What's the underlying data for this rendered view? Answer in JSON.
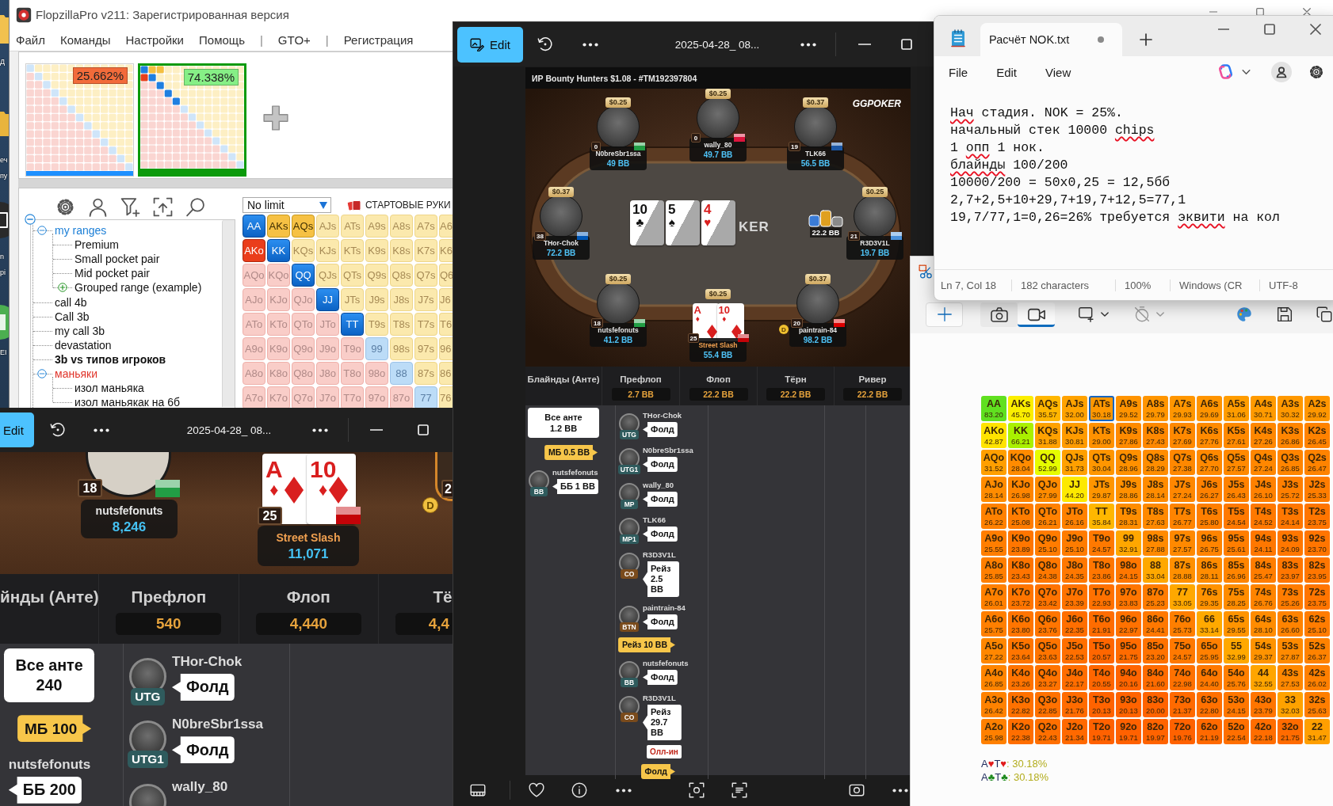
{
  "desktop": {
    "icon_labels": [
      "Д",
      "еч",
      "пу",
      "n",
      "pi",
      "EI"
    ]
  },
  "flopzilla": {
    "title": "FlopzillaPro v211: Зарегистрированная версия",
    "menu": [
      {
        "label": "Файл",
        "kind": "item"
      },
      {
        "label": "Команды",
        "kind": "item"
      },
      {
        "label": "Настройки",
        "kind": "item"
      },
      {
        "label": "Помощь",
        "kind": "item"
      },
      {
        "label": "|",
        "kind": "separator"
      },
      {
        "label": "GTO+",
        "kind": "item"
      },
      {
        "label": "|",
        "kind": "separator"
      },
      {
        "label": "Регистрация",
        "kind": "item"
      }
    ],
    "ranges": [
      {
        "percent": "25.662%",
        "color": "#f26b3a",
        "selected": false
      },
      {
        "percent": "74.338%",
        "color": "#86ef86",
        "selected": true
      }
    ],
    "game_select": {
      "value": "No limit"
    },
    "hands_title": "СТАРТОВЫЕ РУКИ",
    "tree": {
      "expanded": true,
      "children": [
        {
          "label": "my ranges",
          "color": "#1a7ed6",
          "bold": false,
          "expanded": true,
          "children": [
            {
              "label": "Premium",
              "color": "#111111",
              "bold": false
            },
            {
              "label": "Small pocket pair",
              "color": "#111111",
              "bold": false
            },
            {
              "label": "Mid pocket pair",
              "color": "#111111",
              "bold": false
            },
            {
              "label": "Grouped range (example)",
              "color": "#111111",
              "bold": false,
              "expanded": false
            }
          ]
        },
        {
          "label": "call 4b",
          "color": "#111111",
          "bold": false
        },
        {
          "label": "Call 3b",
          "color": "#111111",
          "bold": false
        },
        {
          "label": "my call 3b",
          "color": "#111111",
          "bold": false
        },
        {
          "label": "devastation",
          "color": "#111111",
          "bold": false
        },
        {
          "label": "3b vs типов игроков",
          "color": "#111111",
          "bold": true
        },
        {
          "label": "маньяки",
          "color": "#e0342a",
          "bold": false,
          "expanded": true,
          "children": [
            {
              "label": "изол маньяка",
              "color": "#111111",
              "bold": false
            },
            {
              "label": "изол маньякак на 6б",
              "color": "#111111",
              "bold": false
            }
          ]
        }
      ]
    },
    "matrix": [
      [
        {
          "label": "AA",
          "kind": "pair",
          "selected": true
        },
        {
          "label": "AKs",
          "kind": "suited",
          "selected": true
        },
        {
          "label": "AQs",
          "kind": "suited",
          "selected": true
        },
        {
          "label": "AJs",
          "kind": "suited",
          "selected": false
        },
        {
          "label": "ATs",
          "kind": "suited",
          "selected": false
        },
        {
          "label": "A9s",
          "kind": "suited",
          "selected": false
        },
        {
          "label": "A8s",
          "kind": "suited",
          "selected": false
        },
        {
          "label": "A7s",
          "kind": "suited",
          "selected": false
        },
        {
          "label": "A6",
          "kind": "suited",
          "selected": false
        }
      ],
      [
        {
          "label": "AKo",
          "kind": "offsuit",
          "selected": true
        },
        {
          "label": "KK",
          "kind": "pair",
          "selected": true
        },
        {
          "label": "KQs",
          "kind": "suited",
          "selected": false
        },
        {
          "label": "KJs",
          "kind": "suited",
          "selected": false
        },
        {
          "label": "KTs",
          "kind": "suited",
          "selected": false
        },
        {
          "label": "K9s",
          "kind": "suited",
          "selected": false
        },
        {
          "label": "K8s",
          "kind": "suited",
          "selected": false
        },
        {
          "label": "K7s",
          "kind": "suited",
          "selected": false
        },
        {
          "label": "K6",
          "kind": "suited",
          "selected": false
        }
      ],
      [
        {
          "label": "AQo",
          "kind": "offsuit",
          "selected": false
        },
        {
          "label": "KQo",
          "kind": "offsuit",
          "selected": false
        },
        {
          "label": "QQ",
          "kind": "pair",
          "selected": true
        },
        {
          "label": "QJs",
          "kind": "suited",
          "selected": false
        },
        {
          "label": "QTs",
          "kind": "suited",
          "selected": false
        },
        {
          "label": "Q9s",
          "kind": "suited",
          "selected": false
        },
        {
          "label": "Q8s",
          "kind": "suited",
          "selected": false
        },
        {
          "label": "Q7s",
          "kind": "suited",
          "selected": false
        },
        {
          "label": "Q6",
          "kind": "suited",
          "selected": false
        }
      ],
      [
        {
          "label": "AJo",
          "kind": "offsuit",
          "selected": false
        },
        {
          "label": "KJo",
          "kind": "offsuit",
          "selected": false
        },
        {
          "label": "QJo",
          "kind": "offsuit",
          "selected": false
        },
        {
          "label": "JJ",
          "kind": "pair",
          "selected": true
        },
        {
          "label": "JTs",
          "kind": "suited",
          "selected": false
        },
        {
          "label": "J9s",
          "kind": "suited",
          "selected": false
        },
        {
          "label": "J8s",
          "kind": "suited",
          "selected": false
        },
        {
          "label": "J7s",
          "kind": "suited",
          "selected": false
        },
        {
          "label": "J6",
          "kind": "suited",
          "selected": false
        }
      ],
      [
        {
          "label": "ATo",
          "kind": "offsuit",
          "selected": false
        },
        {
          "label": "KTo",
          "kind": "offsuit",
          "selected": false
        },
        {
          "label": "QTo",
          "kind": "offsuit",
          "selected": false
        },
        {
          "label": "JTo",
          "kind": "offsuit",
          "selected": false
        },
        {
          "label": "TT",
          "kind": "pair",
          "selected": true
        },
        {
          "label": "T9s",
          "kind": "suited",
          "selected": false
        },
        {
          "label": "T8s",
          "kind": "suited",
          "selected": false
        },
        {
          "label": "T7s",
          "kind": "suited",
          "selected": false
        },
        {
          "label": "T6",
          "kind": "suited",
          "selected": false
        }
      ],
      [
        {
          "label": "A9o",
          "kind": "offsuit",
          "selected": false
        },
        {
          "label": "K9o",
          "kind": "offsuit",
          "selected": false
        },
        {
          "label": "Q9o",
          "kind": "offsuit",
          "selected": false
        },
        {
          "label": "J9o",
          "kind": "offsuit",
          "selected": false
        },
        {
          "label": "T9o",
          "kind": "offsuit",
          "selected": false
        },
        {
          "label": "99",
          "kind": "pair",
          "selected": false
        },
        {
          "label": "98s",
          "kind": "suited",
          "selected": false
        },
        {
          "label": "97s",
          "kind": "suited",
          "selected": false
        },
        {
          "label": "96",
          "kind": "suited",
          "selected": false
        }
      ],
      [
        {
          "label": "A8o",
          "kind": "offsuit",
          "selected": false
        },
        {
          "label": "K8o",
          "kind": "offsuit",
          "selected": false
        },
        {
          "label": "Q8o",
          "kind": "offsuit",
          "selected": false
        },
        {
          "label": "J8o",
          "kind": "offsuit",
          "selected": false
        },
        {
          "label": "T8o",
          "kind": "offsuit",
          "selected": false
        },
        {
          "label": "98o",
          "kind": "offsuit",
          "selected": false
        },
        {
          "label": "88",
          "kind": "pair",
          "selected": false
        },
        {
          "label": "87s",
          "kind": "suited",
          "selected": false
        },
        {
          "label": "86",
          "kind": "suited",
          "selected": false
        }
      ],
      [
        {
          "label": "A7o",
          "kind": "offsuit",
          "selected": false
        },
        {
          "label": "K7o",
          "kind": "offsuit",
          "selected": false
        },
        {
          "label": "Q7o",
          "kind": "offsuit",
          "selected": false
        },
        {
          "label": "J7o",
          "kind": "offsuit",
          "selected": false
        },
        {
          "label": "T7o",
          "kind": "offsuit",
          "selected": false
        },
        {
          "label": "97o",
          "kind": "offsuit",
          "selected": false
        },
        {
          "label": "87o",
          "kind": "offsuit",
          "selected": false
        },
        {
          "label": "77",
          "kind": "pair",
          "selected": false
        },
        {
          "label": "76",
          "kind": "suited",
          "selected": false
        }
      ]
    ]
  },
  "viewer_left": {
    "edit_button": "Edit",
    "title": "2025-04-28_ 08...",
    "seats": [
      {
        "name": "nutsfefonuts",
        "stack": "8,246",
        "badge": "18",
        "flag": {
          "color": "#229e45"
        },
        "hero": false
      },
      {
        "name": "Street Slash",
        "stack": "11,071",
        "badge": "25",
        "flag": {
          "color": "#c40308"
        },
        "hero": true,
        "cards": [
          {
            "rank": "A",
            "suit": "♦",
            "color": "#d91f1f",
            "kind": "diamond"
          },
          {
            "rank": "10",
            "suit": "♦",
            "color": "#d91f1f",
            "kind": "diamond"
          }
        ]
      }
    ],
    "edge_seat": {
      "badge": "2",
      "dealer": "D"
    },
    "hand_history": {
      "streets": [
        {
          "label": "йнды (Анте)"
        },
        {
          "label": "Префлоп",
          "pot": "540"
        },
        {
          "label": "Флоп",
          "pot": "4,440"
        },
        {
          "label": "Тё",
          "pot": "4,4"
        }
      ],
      "columns": [
        [
          {
            "kind": "ante",
            "label": "Все анте",
            "amount": "240"
          },
          {
            "kind": "own",
            "action": "МБ 100"
          },
          {
            "kind": "player",
            "name": "nutsfefonuts",
            "avatar": false,
            "action": "ББ 200"
          }
        ],
        [
          {
            "kind": "player",
            "name": "THor-Chok",
            "avatar": true,
            "position": "UTG",
            "color": "#2f5b5d",
            "action": "Фолд"
          },
          {
            "kind": "player",
            "name": "N0breSbr1ssa",
            "avatar": true,
            "position": "UTG1",
            "color": "#2f5b5d",
            "action": "Фолд"
          },
          {
            "kind": "player",
            "name": "wally_80",
            "avatar": true
          }
        ]
      ]
    }
  },
  "viewer_center": {
    "edit_button": "Edit",
    "title": "2025-04-28_ 08...",
    "table_header": "ИР Bounty Hunters $1.08 - #TM192397804",
    "logo": "GGPOKER",
    "felt_text": "KER",
    "board": [
      {
        "rank": "10",
        "suit": "♣",
        "color": "#111111"
      },
      {
        "rank": "5",
        "suit": "♠",
        "color": "#111111"
      },
      {
        "rank": "4",
        "suit": "♥",
        "color": "#d91f1f"
      }
    ],
    "bet": "22.2 BB",
    "seats": [
      {
        "name": "N0breSbr1ssa",
        "stack": "49 BB",
        "bounty": "$0.25",
        "badge": "0",
        "flag": {
          "color": "#229e45"
        },
        "hero": false
      },
      {
        "name": "wally_80",
        "stack": "49.7 BB",
        "bounty": "$0.25",
        "badge": "0",
        "flag": {
          "color": "#dc143c"
        },
        "hero": false
      },
      {
        "name": "TLK66",
        "stack": "56.5 BB",
        "bounty": "$0.37",
        "badge": "19",
        "flag": {
          "color": "#1c57a5"
        },
        "hero": false
      },
      {
        "name": "THor-Chok",
        "stack": "72.2 BB",
        "bounty": "$0.37",
        "badge": "38",
        "flag": {
          "color": "#0057b7"
        },
        "hero": false
      },
      {
        "name": "R3D3V1L",
        "stack": "19.7 BB",
        "bounty": "$0.25",
        "badge": "21",
        "flag": {
          "color": "#4a90d9"
        },
        "hero": false
      },
      {
        "name": "nutsfefonuts",
        "stack": "41.2 BB",
        "bounty": "$0.25",
        "badge": "18",
        "flag": {
          "color": "#229e45"
        },
        "hero": false
      },
      {
        "name": "Street Slash",
        "stack": "55.4 BB",
        "bounty": "$0.25",
        "badge": "25",
        "flag": {
          "color": "#c40308"
        },
        "hero": true,
        "cards": [
          {
            "rank": "A",
            "suit": "♦",
            "color": "#d91f1f",
            "kind": "diamond"
          },
          {
            "rank": "10",
            "suit": "♦",
            "color": "#d91f1f",
            "kind": "diamond"
          }
        ]
      },
      {
        "name": "paintrain-84",
        "stack": "98.2 BB",
        "bounty": "$0.37",
        "badge": "20",
        "flag": {
          "color": "#dd0000"
        },
        "hero": false,
        "dealer": "D"
      }
    ],
    "hand_history": {
      "streets": [
        {
          "label": "Блайнды (Анте)"
        },
        {
          "label": "Префлоп",
          "pot": "2.7 BB"
        },
        {
          "label": "Флоп",
          "pot": "22.2 BB"
        },
        {
          "label": "Тёрн",
          "pot": "22.2 BB"
        },
        {
          "label": "Ривер",
          "pot": "22.2 BB"
        }
      ],
      "columns": [
        [
          {
            "kind": "ante",
            "label": "Все анте",
            "amount": "1.2 BB"
          },
          {
            "kind": "own",
            "action": "МБ 0.5 BB"
          },
          {
            "kind": "player",
            "name": "nutsfefonuts",
            "avatar": true,
            "position": "BB",
            "color": "#2f5b5d",
            "action": "ББ 1 BB"
          }
        ],
        [
          {
            "kind": "player",
            "name": "THor-Chok",
            "avatar": true,
            "position": "UTG",
            "color": "#2f5b5d",
            "action": "Фолд"
          },
          {
            "kind": "player",
            "name": "N0breSbr1ssa",
            "avatar": true,
            "position": "UTG1",
            "color": "#2f5b5d",
            "action": "Фолд"
          },
          {
            "kind": "player",
            "name": "wally_80",
            "avatar": true,
            "position": "MP",
            "color": "#2f5b5d",
            "action": "Фолд"
          },
          {
            "kind": "player",
            "name": "TLK66",
            "avatar": true,
            "position": "MP1",
            "color": "#2f5b5d",
            "action": "Фолд"
          },
          {
            "kind": "player",
            "name": "R3D3V1L",
            "avatar": true,
            "position": "CO",
            "color": "#7a4b1c",
            "action": "Рейз 2.5 BB"
          },
          {
            "kind": "player",
            "name": "paintrain-84",
            "avatar": true,
            "position": "BTN",
            "color": "#7a4b1c",
            "action": "Фолд"
          },
          {
            "kind": "own",
            "action": "Рейз 10 BB"
          },
          {
            "kind": "player",
            "name": "nutsfefonuts",
            "avatar": true,
            "position": "BB",
            "color": "#2f5b5d",
            "action": "Фолд"
          },
          {
            "kind": "player",
            "name": "R3D3V1L",
            "avatar": true,
            "position": "CO",
            "color": "#7a4b1c",
            "action": "Рейз 29.7 BB",
            "tag": "Олл-ин"
          },
          {
            "kind": "own",
            "action": "Фолд"
          }
        ]
      ]
    }
  },
  "notepad": {
    "tab_title": "Расчёт NOK.txt",
    "unsaved": true,
    "menu": [
      "File",
      "Edit",
      "View"
    ],
    "lines": [
      [
        {
          "text": "Нач",
          "misspelled": true
        },
        {
          "text": " стадия. NOK = 25%.",
          "misspelled": false
        }
      ],
      [
        {
          "text": "начальный стек 10000 ",
          "misspelled": false
        },
        {
          "text": "chips",
          "misspelled": true
        }
      ],
      [
        {
          "text": "1 ",
          "misspelled": false
        },
        {
          "text": "опп",
          "misspelled": true
        },
        {
          "text": " 1 нок.",
          "misspelled": false
        }
      ],
      [
        {
          "text": "блайнды",
          "misspelled": true
        },
        {
          "text": " 100/200",
          "misspelled": false
        }
      ],
      [
        {
          "text": "10000/200 = 50x0,25 = 12,5бб",
          "misspelled": false
        }
      ],
      [
        {
          "text": "2,7+2,5+10+29,7+19,7+12,5=77,1",
          "misspelled": false
        }
      ],
      [
        {
          "text": "19,7/77,1=0,26=26% требуется ",
          "misspelled": false
        },
        {
          "text": "эквити",
          "misspelled": true
        },
        {
          "text": " на кол",
          "misspelled": false
        }
      ]
    ],
    "status": [
      "Ln 7, Col 18",
      "182 characters",
      "100%",
      "Windows (CR",
      "UTF-8"
    ]
  },
  "snipping": {
    "capture_modes": [
      {
        "kind": "photo",
        "selected": false
      },
      {
        "kind": "video",
        "selected": true
      }
    ]
  },
  "equity_grid": {
    "rows": [
      [
        {
          "hand": "AA",
          "equity": "83.20",
          "selected": false
        },
        {
          "hand": "AKs",
          "equity": "45.70",
          "selected": false
        },
        {
          "hand": "AQs",
          "equity": "35.57",
          "selected": false
        },
        {
          "hand": "AJs",
          "equity": "32.00",
          "selected": false
        },
        {
          "hand": "ATs",
          "equity": "30.18",
          "selected": true
        },
        {
          "hand": "A9s",
          "equity": "29.52",
          "selected": false
        },
        {
          "hand": "A8s",
          "equity": "29.79",
          "selected": false
        },
        {
          "hand": "A7s",
          "equity": "29.93",
          "selected": false
        },
        {
          "hand": "A6s",
          "equity": "29.69",
          "selected": false
        },
        {
          "hand": "A5s",
          "equity": "31.06",
          "selected": false
        },
        {
          "hand": "A4s",
          "equity": "30.71",
          "selected": false
        },
        {
          "hand": "A3s",
          "equity": "30.32",
          "selected": false
        },
        {
          "hand": "A2s",
          "equity": "29.92",
          "selected": false
        }
      ],
      [
        {
          "hand": "AKo",
          "equity": "42.87",
          "selected": false
        },
        {
          "hand": "KK",
          "equity": "66.21",
          "selected": false
        },
        {
          "hand": "KQs",
          "equity": "31.88",
          "selected": false
        },
        {
          "hand": "KJs",
          "equity": "30.81",
          "selected": false
        },
        {
          "hand": "KTs",
          "equity": "29.00",
          "selected": false
        },
        {
          "hand": "K9s",
          "equity": "27.86",
          "selected": false
        },
        {
          "hand": "K8s",
          "equity": "27.43",
          "selected": false
        },
        {
          "hand": "K7s",
          "equity": "27.69",
          "selected": false
        },
        {
          "hand": "K6s",
          "equity": "27.76",
          "selected": false
        },
        {
          "hand": "K5s",
          "equity": "27.61",
          "selected": false
        },
        {
          "hand": "K4s",
          "equity": "27.26",
          "selected": false
        },
        {
          "hand": "K3s",
          "equity": "26.86",
          "selected": false
        },
        {
          "hand": "K2s",
          "equity": "26.45",
          "selected": false
        }
      ],
      [
        {
          "hand": "AQo",
          "equity": "31.52",
          "selected": false
        },
        {
          "hand": "KQo",
          "equity": "28.04",
          "selected": false
        },
        {
          "hand": "QQ",
          "equity": "52.99",
          "selected": false
        },
        {
          "hand": "QJs",
          "equity": "31.73",
          "selected": false
        },
        {
          "hand": "QTs",
          "equity": "30.04",
          "selected": false
        },
        {
          "hand": "Q9s",
          "equity": "28.96",
          "selected": false
        },
        {
          "hand": "Q8s",
          "equity": "28.29",
          "selected": false
        },
        {
          "hand": "Q7s",
          "equity": "27.38",
          "selected": false
        },
        {
          "hand": "Q6s",
          "equity": "27.70",
          "selected": false
        },
        {
          "hand": "Q5s",
          "equity": "27.57",
          "selected": false
        },
        {
          "hand": "Q4s",
          "equity": "27.24",
          "selected": false
        },
        {
          "hand": "Q3s",
          "equity": "26.85",
          "selected": false
        },
        {
          "hand": "Q2s",
          "equity": "26.47",
          "selected": false
        }
      ],
      [
        {
          "hand": "AJo",
          "equity": "28.14",
          "selected": false
        },
        {
          "hand": "KJo",
          "equity": "26.98",
          "selected": false
        },
        {
          "hand": "QJo",
          "equity": "27.99",
          "selected": false
        },
        {
          "hand": "JJ",
          "equity": "44.20",
          "selected": false
        },
        {
          "hand": "JTs",
          "equity": "29.87",
          "selected": false
        },
        {
          "hand": "J9s",
          "equity": "28.86",
          "selected": false
        },
        {
          "hand": "J8s",
          "equity": "28.14",
          "selected": false
        },
        {
          "hand": "J7s",
          "equity": "27.24",
          "selected": false
        },
        {
          "hand": "J6s",
          "equity": "26.27",
          "selected": false
        },
        {
          "hand": "J5s",
          "equity": "26.43",
          "selected": false
        },
        {
          "hand": "J4s",
          "equity": "26.10",
          "selected": false
        },
        {
          "hand": "J3s",
          "equity": "25.72",
          "selected": false
        },
        {
          "hand": "J2s",
          "equity": "25.33",
          "selected": false
        }
      ],
      [
        {
          "hand": "ATo",
          "equity": "26.22",
          "selected": false
        },
        {
          "hand": "KTo",
          "equity": "25.08",
          "selected": false
        },
        {
          "hand": "QTo",
          "equity": "26.21",
          "selected": false
        },
        {
          "hand": "JTo",
          "equity": "26.16",
          "selected": false
        },
        {
          "hand": "TT",
          "equity": "35.84",
          "selected": false
        },
        {
          "hand": "T9s",
          "equity": "28.31",
          "selected": false
        },
        {
          "hand": "T8s",
          "equity": "27.63",
          "selected": false
        },
        {
          "hand": "T7s",
          "equity": "26.77",
          "selected": false
        },
        {
          "hand": "T6s",
          "equity": "25.80",
          "selected": false
        },
        {
          "hand": "T5s",
          "equity": "24.54",
          "selected": false
        },
        {
          "hand": "T4s",
          "equity": "24.52",
          "selected": false
        },
        {
          "hand": "T3s",
          "equity": "24.14",
          "selected": false
        },
        {
          "hand": "T2s",
          "equity": "23.75",
          "selected": false
        }
      ],
      [
        {
          "hand": "A9o",
          "equity": "25.55",
          "selected": false
        },
        {
          "hand": "K9o",
          "equity": "23.89",
          "selected": false
        },
        {
          "hand": "Q9o",
          "equity": "25.10",
          "selected": false
        },
        {
          "hand": "J9o",
          "equity": "25.10",
          "selected": false
        },
        {
          "hand": "T9o",
          "equity": "24.57",
          "selected": false
        },
        {
          "hand": "99",
          "equity": "32.91",
          "selected": false
        },
        {
          "hand": "98s",
          "equity": "27.88",
          "selected": false
        },
        {
          "hand": "97s",
          "equity": "27.57",
          "selected": false
        },
        {
          "hand": "96s",
          "equity": "26.75",
          "selected": false
        },
        {
          "hand": "95s",
          "equity": "25.61",
          "selected": false
        },
        {
          "hand": "94s",
          "equity": "24.11",
          "selected": false
        },
        {
          "hand": "93s",
          "equity": "24.09",
          "selected": false
        },
        {
          "hand": "92s",
          "equity": "23.70",
          "selected": false
        }
      ],
      [
        {
          "hand": "A8o",
          "equity": "25.85",
          "selected": false
        },
        {
          "hand": "K8o",
          "equity": "23.43",
          "selected": false
        },
        {
          "hand": "Q8o",
          "equity": "24.38",
          "selected": false
        },
        {
          "hand": "J8o",
          "equity": "24.35",
          "selected": false
        },
        {
          "hand": "T8o",
          "equity": "23.86",
          "selected": false
        },
        {
          "hand": "98o",
          "equity": "24.15",
          "selected": false
        },
        {
          "hand": "88",
          "equity": "33.04",
          "selected": false
        },
        {
          "hand": "87s",
          "equity": "28.88",
          "selected": false
        },
        {
          "hand": "86s",
          "equity": "28.11",
          "selected": false
        },
        {
          "hand": "85s",
          "equity": "26.96",
          "selected": false
        },
        {
          "hand": "84s",
          "equity": "25.47",
          "selected": false
        },
        {
          "hand": "83s",
          "equity": "23.97",
          "selected": false
        },
        {
          "hand": "82s",
          "equity": "23.95",
          "selected": false
        }
      ],
      [
        {
          "hand": "A7o",
          "equity": "26.01",
          "selected": false
        },
        {
          "hand": "K7o",
          "equity": "23.72",
          "selected": false
        },
        {
          "hand": "Q7o",
          "equity": "23.42",
          "selected": false
        },
        {
          "hand": "J7o",
          "equity": "23.39",
          "selected": false
        },
        {
          "hand": "T7o",
          "equity": "22.93",
          "selected": false
        },
        {
          "hand": "97o",
          "equity": "23.83",
          "selected": false
        },
        {
          "hand": "87o",
          "equity": "25.23",
          "selected": false
        },
        {
          "hand": "77",
          "equity": "33.05",
          "selected": false
        },
        {
          "hand": "76s",
          "equity": "29.35",
          "selected": false
        },
        {
          "hand": "75s",
          "equity": "28.25",
          "selected": false
        },
        {
          "hand": "74s",
          "equity": "26.76",
          "selected": false
        },
        {
          "hand": "73s",
          "equity": "25.26",
          "selected": false
        },
        {
          "hand": "72s",
          "equity": "23.75",
          "selected": false
        }
      ],
      [
        {
          "hand": "A6o",
          "equity": "25.75",
          "selected": false
        },
        {
          "hand": "K6o",
          "equity": "23.80",
          "selected": false
        },
        {
          "hand": "Q6o",
          "equity": "23.76",
          "selected": false
        },
        {
          "hand": "J6o",
          "equity": "22.35",
          "selected": false
        },
        {
          "hand": "T6o",
          "equity": "21.91",
          "selected": false
        },
        {
          "hand": "96o",
          "equity": "22.97",
          "selected": false
        },
        {
          "hand": "86o",
          "equity": "24.41",
          "selected": false
        },
        {
          "hand": "76o",
          "equity": "25.73",
          "selected": false
        },
        {
          "hand": "66",
          "equity": "33.14",
          "selected": false
        },
        {
          "hand": "65s",
          "equity": "29.55",
          "selected": false
        },
        {
          "hand": "64s",
          "equity": "28.10",
          "selected": false
        },
        {
          "hand": "63s",
          "equity": "26.60",
          "selected": false
        },
        {
          "hand": "62s",
          "equity": "25.10",
          "selected": false
        }
      ],
      [
        {
          "hand": "A5o",
          "equity": "27.22",
          "selected": false
        },
        {
          "hand": "K5o",
          "equity": "23.64",
          "selected": false
        },
        {
          "hand": "Q5o",
          "equity": "23.63",
          "selected": false
        },
        {
          "hand": "J5o",
          "equity": "22.53",
          "selected": false
        },
        {
          "hand": "T5o",
          "equity": "20.57",
          "selected": false
        },
        {
          "hand": "95o",
          "equity": "21.75",
          "selected": false
        },
        {
          "hand": "85o",
          "equity": "23.20",
          "selected": false
        },
        {
          "hand": "75o",
          "equity": "24.57",
          "selected": false
        },
        {
          "hand": "65o",
          "equity": "25.95",
          "selected": false
        },
        {
          "hand": "55",
          "equity": "32.99",
          "selected": false
        },
        {
          "hand": "54s",
          "equity": "29.37",
          "selected": false
        },
        {
          "hand": "53s",
          "equity": "27.87",
          "selected": false
        },
        {
          "hand": "52s",
          "equity": "26.37",
          "selected": false
        }
      ],
      [
        {
          "hand": "A4o",
          "equity": "26.85",
          "selected": false
        },
        {
          "hand": "K4o",
          "equity": "23.26",
          "selected": false
        },
        {
          "hand": "Q4o",
          "equity": "23.27",
          "selected": false
        },
        {
          "hand": "J4o",
          "equity": "22.17",
          "selected": false
        },
        {
          "hand": "T4o",
          "equity": "20.55",
          "selected": false
        },
        {
          "hand": "94o",
          "equity": "20.16",
          "selected": false
        },
        {
          "hand": "84o",
          "equity": "21.60",
          "selected": false
        },
        {
          "hand": "74o",
          "equity": "22.98",
          "selected": false
        },
        {
          "hand": "64o",
          "equity": "24.40",
          "selected": false
        },
        {
          "hand": "54o",
          "equity": "25.76",
          "selected": false
        },
        {
          "hand": "44",
          "equity": "32.55",
          "selected": false
        },
        {
          "hand": "43s",
          "equity": "27.53",
          "selected": false
        },
        {
          "hand": "42s",
          "equity": "26.02",
          "selected": false
        }
      ],
      [
        {
          "hand": "A3o",
          "equity": "26.42",
          "selected": false
        },
        {
          "hand": "K3o",
          "equity": "22.82",
          "selected": false
        },
        {
          "hand": "Q3o",
          "equity": "22.85",
          "selected": false
        },
        {
          "hand": "J3o",
          "equity": "21.76",
          "selected": false
        },
        {
          "hand": "T3o",
          "equity": "20.13",
          "selected": false
        },
        {
          "hand": "93o",
          "equity": "20.13",
          "selected": false
        },
        {
          "hand": "83o",
          "equity": "20.00",
          "selected": false
        },
        {
          "hand": "73o",
          "equity": "21.37",
          "selected": false
        },
        {
          "hand": "63o",
          "equity": "22.80",
          "selected": false
        },
        {
          "hand": "53o",
          "equity": "24.15",
          "selected": false
        },
        {
          "hand": "43o",
          "equity": "23.79",
          "selected": false
        },
        {
          "hand": "33",
          "equity": "32.03",
          "selected": false
        },
        {
          "hand": "32s",
          "equity": "25.63",
          "selected": false
        }
      ],
      [
        {
          "hand": "A2o",
          "equity": "25.98",
          "selected": false
        },
        {
          "hand": "K2o",
          "equity": "22.38",
          "selected": false
        },
        {
          "hand": "Q2o",
          "equity": "22.43",
          "selected": false
        },
        {
          "hand": "J2o",
          "equity": "21.34",
          "selected": false
        },
        {
          "hand": "T2o",
          "equity": "19.71",
          "selected": false
        },
        {
          "hand": "92o",
          "equity": "19.71",
          "selected": false
        },
        {
          "hand": "82o",
          "equity": "19.97",
          "selected": false
        },
        {
          "hand": "72o",
          "equity": "19.76",
          "selected": false
        },
        {
          "hand": "62o",
          "equity": "21.19",
          "selected": false
        },
        {
          "hand": "52o",
          "equity": "22.54",
          "selected": false
        },
        {
          "hand": "42o",
          "equity": "22.18",
          "selected": false
        },
        {
          "hand": "32o",
          "equity": "21.75",
          "selected": false
        },
        {
          "hand": "22",
          "equity": "31.47",
          "selected": false
        }
      ]
    ],
    "notes": [
      {
        "cards": [
          {
            "rank": "A",
            "suit": "♥"
          },
          {
            "rank": "T",
            "suit": "♥"
          }
        ],
        "color": "#e01b1b",
        "value": ": 30.18%"
      },
      {
        "cards": [
          {
            "rank": "A",
            "suit": "♣"
          },
          {
            "rank": "T",
            "suit": "♣"
          }
        ],
        "color": "#1e8a1e",
        "value": ": 30.18%"
      }
    ]
  }
}
